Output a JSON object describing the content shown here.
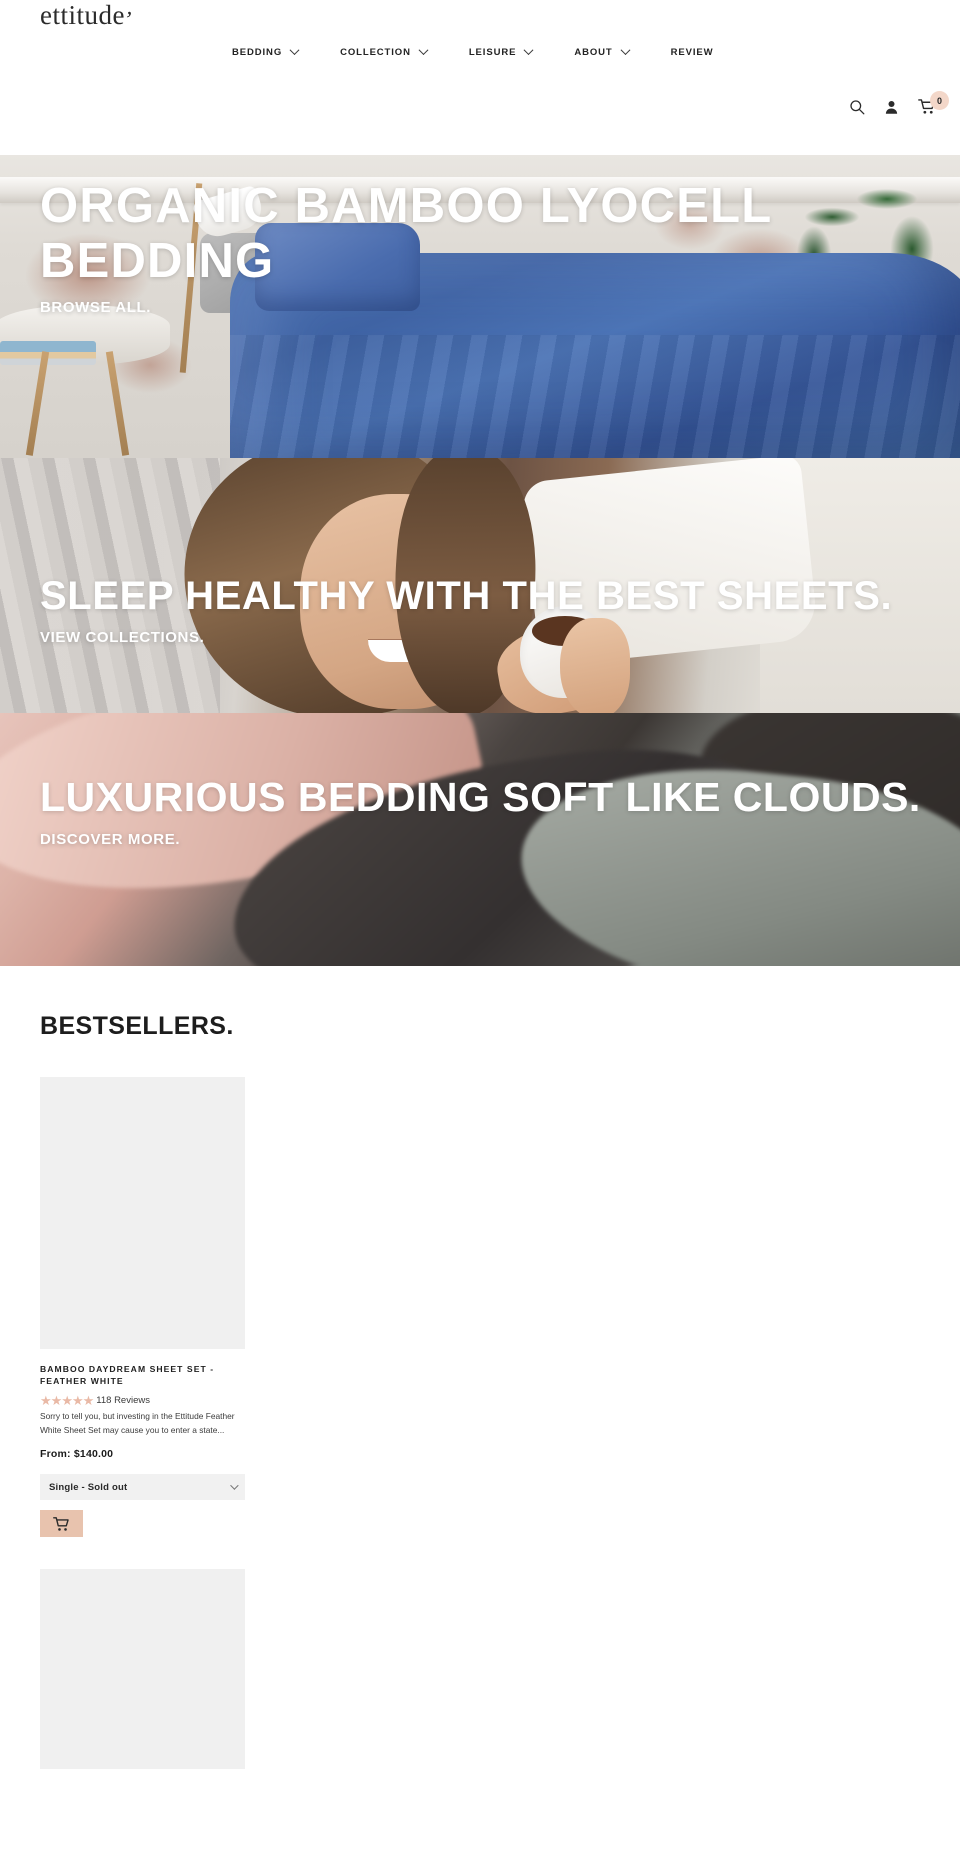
{
  "header": {
    "logo": "ettitude",
    "nav": [
      {
        "label": "BEDDING",
        "has_dropdown": true
      },
      {
        "label": "COLLECTION",
        "has_dropdown": true
      },
      {
        "label": "LEISURE",
        "has_dropdown": true
      },
      {
        "label": "ABOUT",
        "has_dropdown": true
      },
      {
        "label": "REVIEW",
        "has_dropdown": false
      }
    ],
    "icons": {
      "search": "search-icon",
      "account": "account-icon",
      "cart": "cart-icon"
    },
    "cart_count": "0",
    "cart_badge_color": "#f3d7c9"
  },
  "banners": [
    {
      "title": "ORGANIC BAMBOO LYOCELL BEDDING",
      "cta": "BROWSE ALL.",
      "image_alt": "blue-bedding-bedroom"
    },
    {
      "title": "SLEEP HEALTHY WITH THE BEST SHEETS.",
      "cta": "VIEW COLLECTIONS.",
      "image_alt": "woman-with-coffee-in-bed"
    },
    {
      "title": "LUXURIOUS BEDDING SOFT LIKE CLOUDS.",
      "cta": "DISCOVER MORE.",
      "image_alt": "pink-grey-silk-fabric"
    }
  ],
  "bestsellers": {
    "title": "BESTSELLERS.",
    "products": [
      {
        "name": "BAMBOO DAYDREAM SHEET SET - FEATHER WHITE",
        "stars": "★★★★★",
        "star_color": "#e9b9a6",
        "reviews": "118 Reviews",
        "description": "Sorry to tell you, but investing in the Ettitude Feather White Sheet Set may cause you to enter a state...",
        "price": "From: $140.00",
        "variant": "Single - Sold out",
        "add_to_cart": "cart-icon",
        "button_color": "#e8c3ae"
      }
    ]
  }
}
